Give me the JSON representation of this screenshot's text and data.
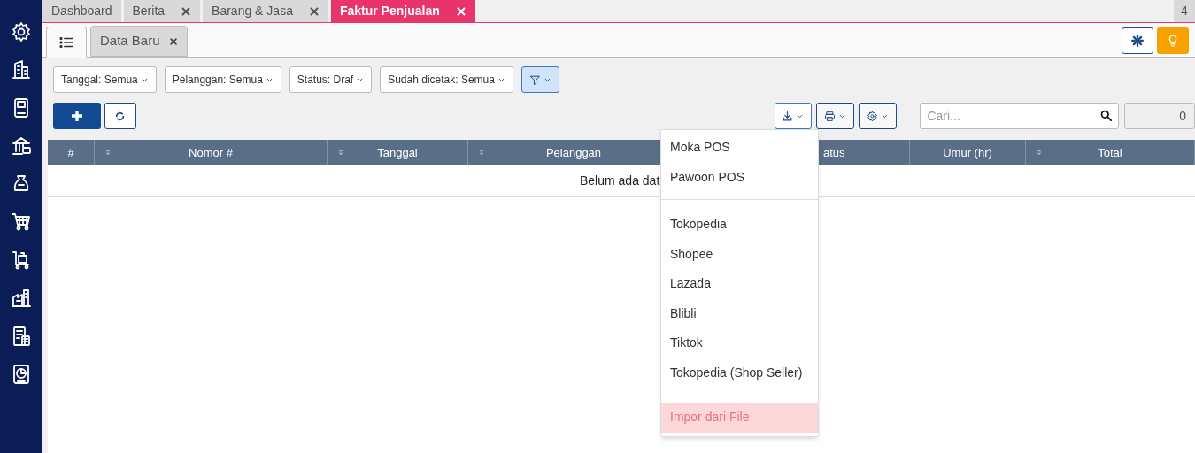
{
  "top_tabs": [
    {
      "label": "Dashboard",
      "closable": false,
      "selected": false
    },
    {
      "label": "Berita",
      "closable": true,
      "selected": false
    },
    {
      "label": "Barang & Jasa",
      "closable": true,
      "selected": false
    },
    {
      "label": "Faktur Penjualan",
      "closable": true,
      "selected": true
    }
  ],
  "tab_count": "4",
  "sub_tabs": [
    {
      "kind": "list",
      "selected": true
    },
    {
      "kind": "text",
      "label": "Data Baru",
      "closable": true,
      "selected": false
    }
  ],
  "filters": [
    {
      "label": "Tanggal: Semua"
    },
    {
      "label": "Pelanggan: Semua"
    },
    {
      "label": "Status: Draf"
    },
    {
      "label": "Sudah dicetak: Semua"
    }
  ],
  "search": {
    "placeholder": "Cari..."
  },
  "record_count": "0",
  "table": {
    "columns": [
      {
        "label": "#",
        "sortable": false
      },
      {
        "label": "Nomor #",
        "sortable": true
      },
      {
        "label": "Tanggal",
        "sortable": true
      },
      {
        "label": "Pelanggan",
        "sortable": true
      },
      {
        "label": "atus",
        "sortable": false
      },
      {
        "label": "Umur (hr)",
        "sortable": false
      },
      {
        "label": "Total",
        "sortable": true
      }
    ],
    "empty_message": "Belum ada dat"
  },
  "import_menu": {
    "groups": [
      [
        {
          "label": "Moka POS",
          "highlighted": false
        },
        {
          "label": "Pawoon POS",
          "highlighted": false
        }
      ],
      [
        {
          "label": "Tokopedia",
          "highlighted": false
        },
        {
          "label": "Shopee",
          "highlighted": false
        },
        {
          "label": "Lazada",
          "highlighted": false
        },
        {
          "label": "Blibli",
          "highlighted": false
        },
        {
          "label": "Tiktok",
          "highlighted": false
        },
        {
          "label": "Tokopedia (Shop Seller)",
          "highlighted": false
        }
      ],
      [
        {
          "label": "Impor dari File",
          "highlighted": true
        }
      ]
    ]
  }
}
